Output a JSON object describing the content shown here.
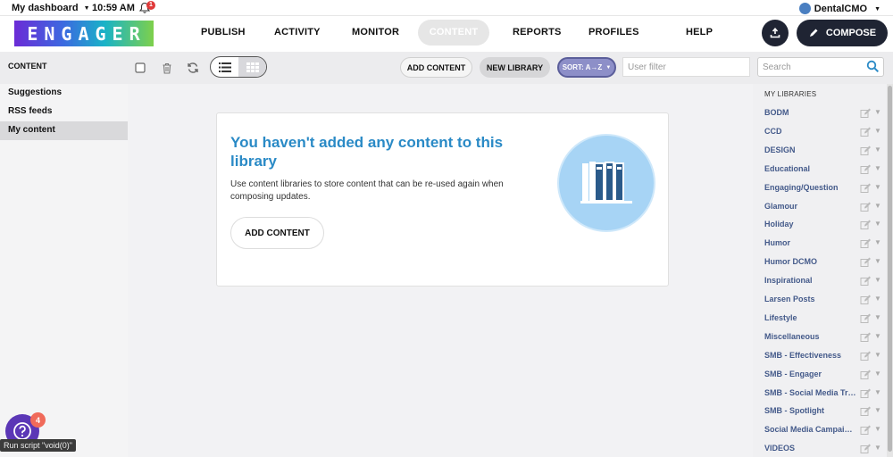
{
  "topbar": {
    "dashboard": "My dashboard",
    "time": "10:59 AM",
    "notif_count": "1",
    "user": "DentalCMO"
  },
  "logo_text": "ENGAGER",
  "nav": {
    "publish": "PUBLISH",
    "activity": "ACTIVITY",
    "monitor": "MONITOR",
    "content": "CONTENT",
    "reports": "REPORTS",
    "profiles": "PROFILES",
    "help": "HELP",
    "compose": "COMPOSE"
  },
  "toolbar": {
    "section": "CONTENT",
    "add_content": "ADD CONTENT",
    "new_library": "NEW LIBRARY",
    "sort": "SORT: A→Z",
    "filter_placeholder": "User filter",
    "search_placeholder": "Search"
  },
  "sidebar": {
    "items": [
      {
        "label": "Suggestions"
      },
      {
        "label": "RSS feeds"
      },
      {
        "label": "My content"
      }
    ]
  },
  "empty_state": {
    "title": "You haven't added any content to this library",
    "body": "Use content libraries to store content that can be re-used again when composing updates.",
    "button": "ADD CONTENT"
  },
  "libraries": {
    "header": "MY LIBRARIES",
    "items": [
      "BODM",
      "CCD",
      "DESIGN",
      "Educational",
      "Engaging/Question",
      "Glamour",
      "Holiday",
      "Humor",
      "Humor DCMO",
      "Inspirational",
      "Larsen Posts",
      "Lifestyle",
      "Miscellaneous",
      "SMB - Effectiveness",
      "SMB - Engager",
      "SMB - Social Media Training",
      "SMB - Spotlight",
      "Social Media Campaigns",
      "VIDEOS"
    ]
  },
  "help_badge": "4",
  "status_text": "Run script \"void(0)\"",
  "colors": {
    "accent_blue": "#2a8ac6",
    "nav_dark": "#1f2433",
    "sort_purple": "#8d8fc8",
    "help_purple": "#5b37b6"
  }
}
